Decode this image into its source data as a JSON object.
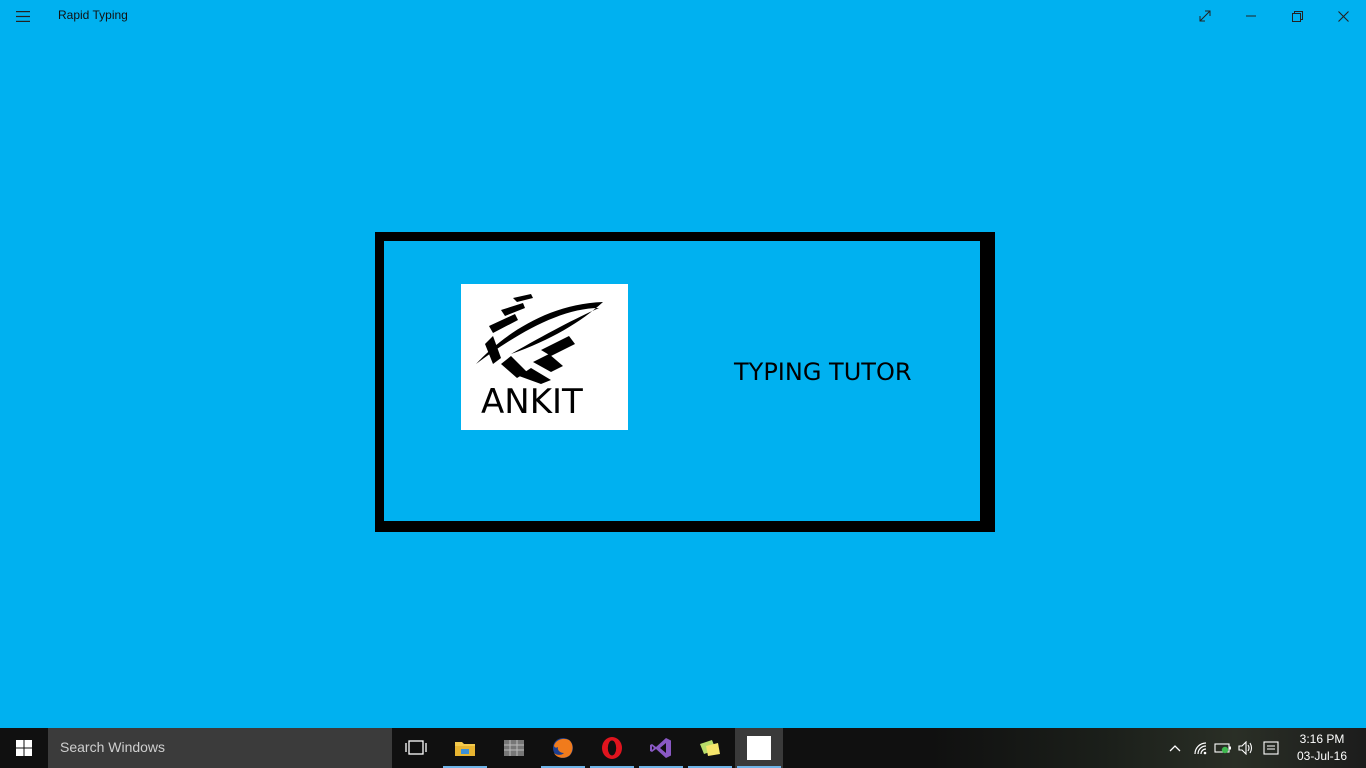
{
  "window": {
    "title": "Rapid Typing",
    "icons": [
      "hamburger-menu-icon",
      "fullscreen-icon",
      "minimize-icon",
      "restore-icon",
      "close-icon"
    ]
  },
  "content": {
    "logo_text": "ANKIT",
    "tagline": "TYPING TUTOR"
  },
  "taskbar": {
    "search_placeholder": "Search Windows",
    "apps": [
      "task-view-icon",
      "file-explorer-icon",
      "app-grid-icon",
      "firefox-icon",
      "opera-icon",
      "visual-studio-icon",
      "sticky-notes-icon",
      "rapid-typing-app-icon"
    ],
    "time": "3:16 PM",
    "date": "03-Jul-16"
  },
  "colors": {
    "background": "#00b1f0",
    "frame": "#000000",
    "taskbar": "#101010",
    "search": "#3b3b3b"
  }
}
